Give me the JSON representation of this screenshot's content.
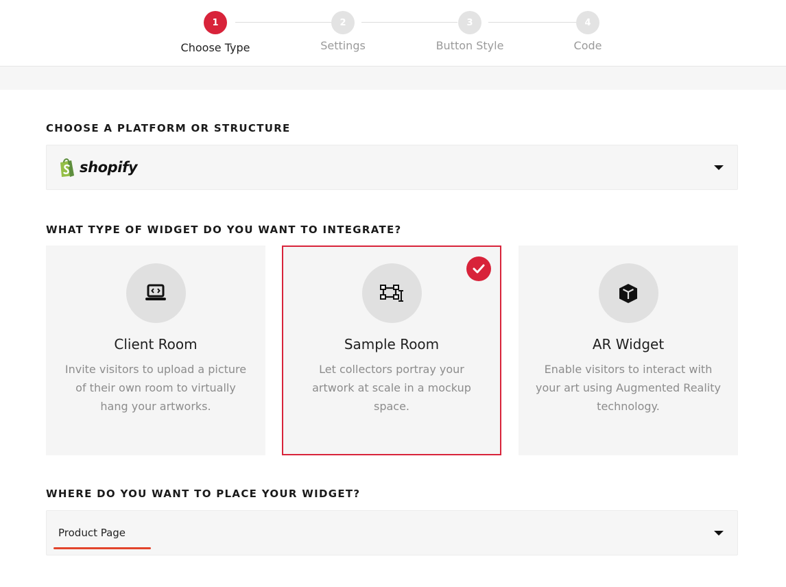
{
  "stepper": {
    "steps": [
      {
        "num": "1",
        "label": "Choose Type",
        "active": true
      },
      {
        "num": "2",
        "label": "Settings",
        "active": false
      },
      {
        "num": "3",
        "label": "Button Style",
        "active": false
      },
      {
        "num": "4",
        "label": "Code",
        "active": false
      }
    ]
  },
  "platform": {
    "title": "CHOOSE A PLATFORM OR STRUCTURE",
    "selected": "shopify"
  },
  "widget": {
    "title": "WHAT TYPE OF WIDGET DO YOU WANT TO INTEGRATE?",
    "options": [
      {
        "name": "Client Room",
        "desc": "Invite visitors to upload a picture of their own room to virtually hang your artworks.",
        "icon": "laptop-code-icon",
        "selected": false
      },
      {
        "name": "Sample Room",
        "desc": "Let collectors portray your artwork at scale in a mockup space.",
        "icon": "vector-square-icon",
        "selected": true
      },
      {
        "name": "AR Widget",
        "desc": "Enable visitors to interact with your art using Augmented Reality technology.",
        "icon": "cube-icon",
        "selected": false
      }
    ]
  },
  "placement": {
    "title": "WHERE DO YOU WANT TO PLACE YOUR WIDGET?",
    "selected": "Product Page"
  },
  "colors": {
    "accent": "#d8233a",
    "shopify_green": "#95bf47",
    "underline": "#e2432b"
  }
}
